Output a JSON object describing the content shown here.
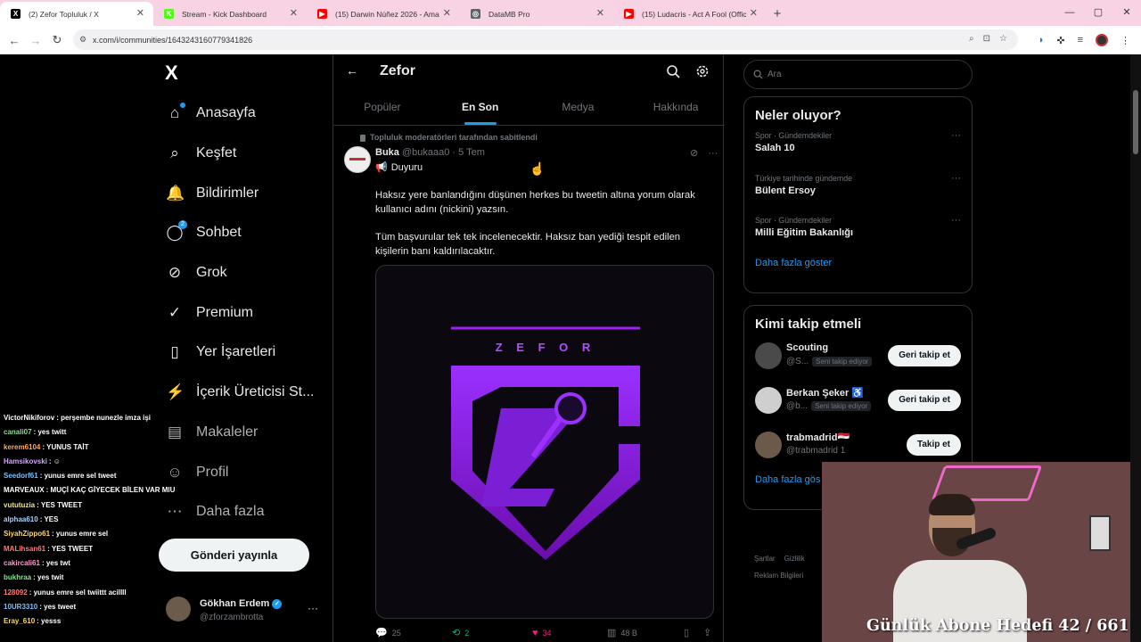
{
  "browser": {
    "tabs": [
      {
        "title": "(2) Zefor Topluluk / X",
        "active": true,
        "icon": "x-icon",
        "icon_glyph": "X",
        "icon_color": "#000000"
      },
      {
        "title": "Stream - Kick Dashboard",
        "active": false,
        "icon": "kick-icon",
        "icon_glyph": "K",
        "icon_color": "#53fc18"
      },
      {
        "title": "(15) Darwin Núñez 2026 - Ama",
        "active": false,
        "icon": "youtube-icon",
        "icon_glyph": "▶",
        "icon_color": "#ff0000"
      },
      {
        "title": "DataMB Pro",
        "active": false,
        "icon": "globe-icon",
        "icon_glyph": "◎",
        "icon_color": "#5f6368"
      },
      {
        "title": "(15) Ludacris - Act A Fool (Offic",
        "active": false,
        "icon": "youtube-icon",
        "icon_glyph": "▶",
        "icon_color": "#ff0000"
      }
    ],
    "new_tab": "+",
    "url": "x.com/i/communities/1643243160779341826",
    "window_controls": [
      "—",
      "▢",
      "✕"
    ]
  },
  "nav": {
    "logo": "X",
    "items": [
      {
        "label": "Anasayfa",
        "icon": "home-icon",
        "glyph": "⌂",
        "dot": true
      },
      {
        "label": "Keşfet",
        "icon": "search-icon",
        "glyph": "⌕"
      },
      {
        "label": "Bildirimler",
        "icon": "bell-icon",
        "glyph": "🔔"
      },
      {
        "label": "Sohbet",
        "icon": "chat-icon",
        "glyph": "◯",
        "badge": "2"
      },
      {
        "label": "Grok",
        "icon": "grok-icon",
        "glyph": "⊘"
      },
      {
        "label": "Premium",
        "icon": "premium-icon",
        "glyph": "✓"
      },
      {
        "label": "Yer İşaretleri",
        "icon": "bookmark-icon",
        "glyph": "▯"
      },
      {
        "label": "İçerik Üreticisi St...",
        "icon": "lightning-icon",
        "glyph": "⚡"
      },
      {
        "label": "Makaleler",
        "icon": "article-icon",
        "glyph": "▤"
      },
      {
        "label": "Profil",
        "icon": "user-icon",
        "glyph": "☺"
      },
      {
        "label": "Daha fazla",
        "icon": "more-circle-icon",
        "glyph": "⋯"
      }
    ],
    "post_button": "Gönderi yayınla",
    "me": {
      "name": "Gökhan Erdem",
      "handle": "@zforzambrotta",
      "more": "···"
    }
  },
  "chat": [
    {
      "user": "VictorNikiforov",
      "color": "#ffffff",
      "text": ": perşembe nunezle imza işi"
    },
    {
      "user": "canali07",
      "color": "#7ee787",
      "text": ": yes twitt"
    },
    {
      "user": "kerem6104",
      "color": "#ffa657",
      "text": ": YUNUS TAİT"
    },
    {
      "user": "Hamsikovski",
      "color": "#d2a8ff",
      "text": ": ☺"
    },
    {
      "user": "Seedorf61",
      "color": "#79c0ff",
      "text": ": yunus emre sel tweet"
    },
    {
      "user": "MARVEAUX",
      "color": "#ffffff",
      "text": ": MUÇİ KAÇ GİYECEK BİLEN VAR MIU"
    },
    {
      "user": "vututuzia",
      "color": "#f0e68c",
      "text": ": YES TWEET"
    },
    {
      "user": "alphaa610",
      "color": "#a5d6ff",
      "text": ": YES"
    },
    {
      "user": "SiyahZippo61",
      "color": "#ffd866",
      "text": ": yunus emre sel"
    },
    {
      "user": "MALihsan61",
      "color": "#ff7b72",
      "text": ": YES TWEET"
    },
    {
      "user": "cakircali61",
      "color": "#ff9bce",
      "text": ": yes twt"
    },
    {
      "user": "bukhraa",
      "color": "#7ee787",
      "text": ": yes twit"
    },
    {
      "user": "128092",
      "color": "#ff7b72",
      "text": ": yunus emre sel twiittt acillll"
    },
    {
      "user": "10UR3310",
      "color": "#79c0ff",
      "text": ": yes tweet"
    },
    {
      "user": "Eray_610",
      "color": "#ffd866",
      "text": ": yesss"
    }
  ],
  "community": {
    "back": "←",
    "title": "Zefor",
    "tabs": [
      {
        "label": "Popüler",
        "active": false
      },
      {
        "label": "En Son",
        "active": true
      },
      {
        "label": "Medya",
        "active": false
      },
      {
        "label": "Hakkında",
        "active": false
      }
    ]
  },
  "post": {
    "pinned_label": "Topluluk moderatörleri tarafından sabitlendi",
    "name": "Buka",
    "handle": "@bukaaa0",
    "time": "· 5 Tem",
    "tag": "Duyuru",
    "paragraph1": "Haksız yere banlandığını düşünen herkes bu tweetin altına yorum olarak kullanıcı adını (nickini) yazsın.",
    "paragraph2": "Tüm başvurular tek tek incelenecektir. Haksız ban yediği tespit edilen kişilerin banı kaldırılacaktır.",
    "logo_letters": "Z E F O R",
    "replies": "25",
    "retweets": "2",
    "likes": "34",
    "views": "48 B"
  },
  "right": {
    "search_placeholder": "Ara",
    "trends_title": "Neler oluyor?",
    "trends": [
      {
        "context": "Spor · Gündemdekiler",
        "topic": "Salah 10"
      },
      {
        "context": "Türkiye tarihinde gündemde",
        "topic": "Bülent Ersoy"
      },
      {
        "context": "Spor · Gündemdekiler",
        "topic": "Milli Eğitim Bakanlığı"
      }
    ],
    "show_more": "Daha fazla göster",
    "who_title": "Kimi takip etmeli",
    "who": [
      {
        "name": "Scouting",
        "handle": "@S...",
        "chip": "Seni takip ediyor",
        "button": "Geri takip et"
      },
      {
        "name": "Berkan Şeker ♿",
        "handle": "@b...",
        "chip": "Seni takip ediyor",
        "button": "Geri takip et"
      },
      {
        "name": "trabmadrid🇪🇬",
        "handle": "@trabmadrid 1",
        "chip": "",
        "button": "Takip et"
      }
    ],
    "who_more": "Daha fazla gös",
    "footer": [
      "Şartlar",
      "Gizlilik",
      "Reklam Bilgileri"
    ]
  },
  "webcam": {
    "overlay_text": "Günlük Abone Hedefi 42 / 661"
  },
  "colors": {
    "accent": "#1d9bf0",
    "retweet": "#00ba7c",
    "like": "#f91880",
    "logo_purple": "#8a2be2"
  }
}
